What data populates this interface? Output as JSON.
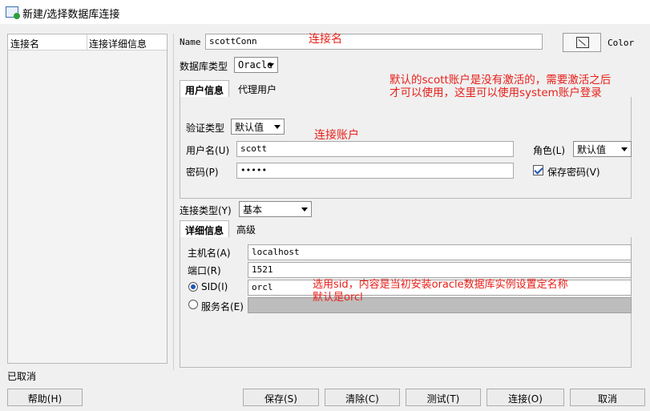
{
  "window": {
    "title": "新建/选择数据库连接"
  },
  "left_panel": {
    "columns": [
      "连接名",
      "连接详细信息"
    ]
  },
  "name_field": {
    "label": "Name",
    "value": "scottConn"
  },
  "color_button": {
    "label": "Color"
  },
  "db_type": {
    "label": "数据库类型",
    "value": "Oracle"
  },
  "user_tabs": [
    "用户信息",
    "代理用户"
  ],
  "auth": {
    "label": "验证类型",
    "value": "默认值"
  },
  "username": {
    "label": "用户名(U)",
    "value": "scott"
  },
  "password": {
    "label": "密码(P)",
    "value": "•••••"
  },
  "role": {
    "label": "角色(L)",
    "value": "默认值"
  },
  "save_password": {
    "label": "保存密码(V)",
    "checked": true
  },
  "conn_type": {
    "label": "连接类型(Y)",
    "value": "基本"
  },
  "detail_tabs": [
    "详细信息",
    "高级"
  ],
  "host": {
    "label": "主机名(A)",
    "value": "localhost"
  },
  "port": {
    "label": "端口(R)",
    "value": "1521"
  },
  "sid": {
    "label": "SID(I)",
    "value": "orcl",
    "selected": true
  },
  "service": {
    "label": "服务名(E)",
    "value": ""
  },
  "status": "已取消",
  "buttons": {
    "help": "帮助(H)",
    "save": "保存(S)",
    "clear": "清除(C)",
    "test": "测试(T)",
    "connect": "连接(O)",
    "cancel": "取消"
  },
  "annotations": {
    "conn_name": "连接名",
    "scott_note_line1": "默认的scott账户是没有激活的，需要激活之后",
    "scott_note_line2": "才可以使用，这里可以使用system账户登录",
    "account": "连接账户",
    "sid_note_line1": "选用sid，内容是当初安装oracle数据库实例设置定名称",
    "sid_note_line2": "默认是orcl"
  }
}
